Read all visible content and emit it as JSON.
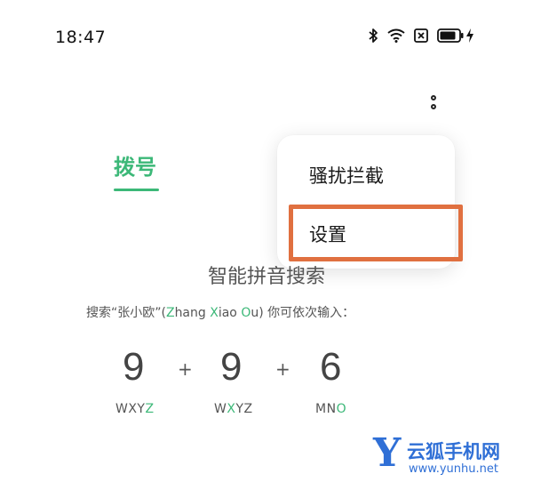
{
  "status_bar": {
    "time": "18:47",
    "icons": [
      "bluetooth-icon",
      "wifi-icon",
      "sim-off-icon",
      "battery-icon",
      "charging-icon"
    ]
  },
  "tabs": {
    "dial_label": "拨号"
  },
  "menu": {
    "items": [
      "骚扰拦截",
      "设置"
    ],
    "highlighted_item": "设置",
    "highlight_color": "#e07040"
  },
  "smart_search": {
    "title": "智能拼音搜索",
    "desc_prefix": "搜索“张小欧”(",
    "desc_z": "Z",
    "desc_hang": "hang ",
    "desc_x": "X",
    "desc_iao": "iao ",
    "desc_o": "O",
    "desc_u": "u",
    "desc_suffix": ") 你可依次输入：",
    "plus": "+",
    "keys": [
      {
        "digit": "9",
        "letters_plain": "WXY",
        "letters_hl": "Z",
        "letters_after": ""
      },
      {
        "digit": "9",
        "letters_plain": "W",
        "letters_hl": "X",
        "letters_after": "YZ"
      },
      {
        "digit": "6",
        "letters_plain": "MN",
        "letters_hl": "O",
        "letters_after": ""
      }
    ]
  },
  "watermark": {
    "logo_letter": "Y",
    "name": "云狐手机网",
    "url": "www.yunhu.net"
  },
  "colors": {
    "accent": "#3cb878",
    "watermark": "#2f6fd6"
  }
}
